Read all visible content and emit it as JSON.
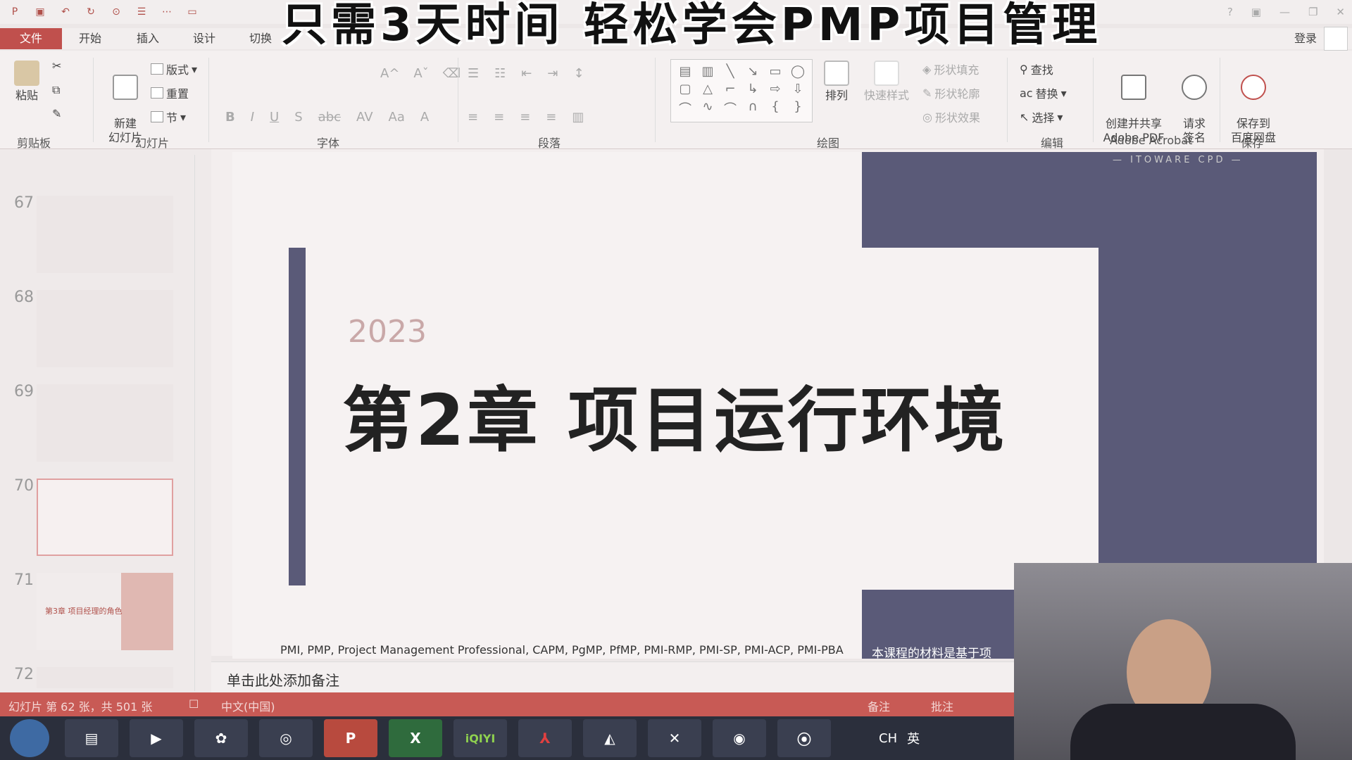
{
  "banner": "只需3天时间 轻松学会PMP项目管理",
  "tabs": [
    "文件",
    "开始",
    "插入",
    "设计",
    "切换"
  ],
  "login": "登录",
  "ribbon": {
    "paste": "粘贴",
    "new_slide": "新建\n幻灯片",
    "layout": "版式",
    "reset": "重置",
    "section": "节",
    "arrange": "排列",
    "quick_style": "快速样式",
    "shape_fill": "形状填充",
    "shape_outline": "形状轮廓",
    "shape_effect": "形状效果",
    "find": "查找",
    "replace": "替换",
    "select": "选择",
    "create_share_pdf": "创建并共享\nAdobe PDF",
    "request_sign": "请求\n签名",
    "save_baidu": "保存到\n百度网盘",
    "groups": {
      "clipboard": "剪贴板",
      "slides": "幻灯片",
      "font": "字体",
      "paragraph": "段落",
      "drawing": "绘图",
      "editing": "编辑",
      "acrobat": "Adobe Acrobat",
      "save": "保存"
    }
  },
  "thumbs": [
    {
      "num": "67"
    },
    {
      "num": "68"
    },
    {
      "num": "69"
    },
    {
      "num": "70"
    },
    {
      "num": "71",
      "title": "第3章 项目经理的角色"
    },
    {
      "num": "72"
    }
  ],
  "slide": {
    "year": "2023",
    "chapter": "第2章  项目运行环境",
    "brand_sub": "— ITOWARE CPD —",
    "footer_left": "PMI, PMP, Project Management Professional, CAPM, PgMP, PfMP, PMI-RMP, PMI-SP, PMI-ACP, PMI-PBA",
    "footer_right": "本课程的材料是基于项"
  },
  "notes": "单击此处添加备注",
  "status": {
    "slide_count": "幻灯片 第 62 张，共 501 张",
    "lang": "中文(中国)",
    "notes_btn": "备注",
    "comments_btn": "批注"
  },
  "taskbar": {
    "ppt": "P",
    "excel": "X",
    "iqiyi": "iQIYI"
  },
  "tray": {
    "lang": "CH",
    "ime": "英"
  }
}
